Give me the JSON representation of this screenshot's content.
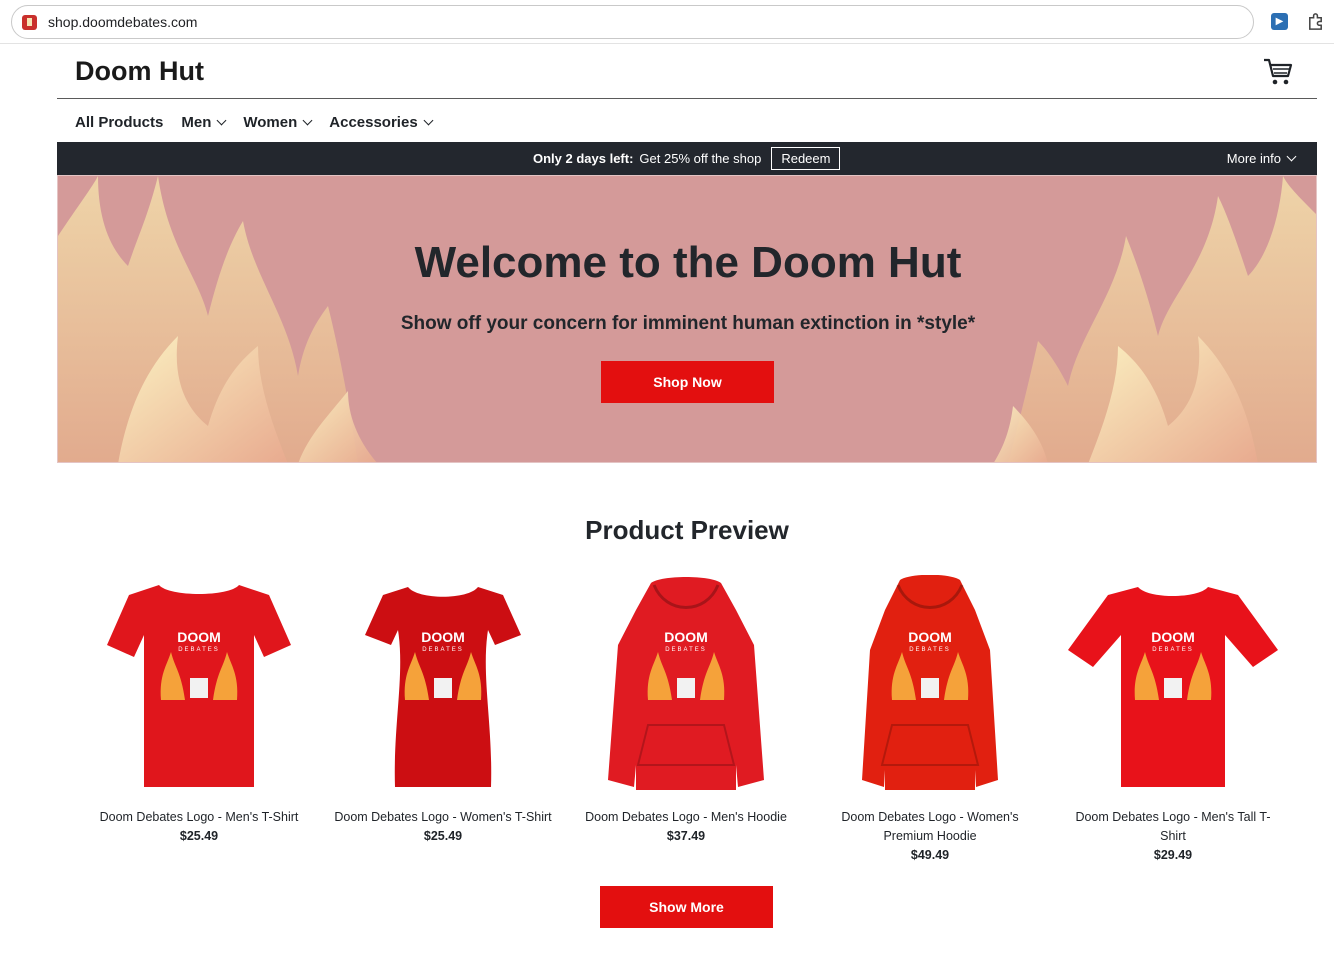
{
  "browser": {
    "url": "shop.doomdebates.com",
    "favicon_icon": "fire-house-icon",
    "extension_icons": [
      "fast-forward-icon",
      "puzzle-piece-icon"
    ]
  },
  "header": {
    "site_title": "Doom Hut",
    "cart_icon": "shopping-cart-icon"
  },
  "nav": {
    "items": [
      {
        "label": "All Products",
        "has_dropdown": false
      },
      {
        "label": "Men",
        "has_dropdown": true
      },
      {
        "label": "Women",
        "has_dropdown": true
      },
      {
        "label": "Accessories",
        "has_dropdown": true
      }
    ]
  },
  "promo": {
    "strong": "Only 2 days left:",
    "text": "Get 25% off the shop",
    "redeem_label": "Redeem",
    "more_info_label": "More info"
  },
  "hero": {
    "title": "Welcome to the Doom Hut",
    "subtitle": "Show off your concern for imminent human extinction in *style*",
    "cta_label": "Shop Now"
  },
  "products_section": {
    "title": "Product Preview",
    "items": [
      {
        "name": "Doom Debates Logo - Men's T-Shirt",
        "price": "$25.49",
        "kind": "tshirt",
        "color": "#e0161c"
      },
      {
        "name": "Doom Debates Logo - Women's T-Shirt",
        "price": "$25.49",
        "kind": "womens-tshirt",
        "color": "#cc0e12"
      },
      {
        "name": "Doom Debates Logo - Men's Hoodie",
        "price": "$37.49",
        "kind": "hoodie",
        "color": "#e01b22"
      },
      {
        "name": "Doom Debates Logo - Women's Premium Hoodie",
        "price": "$49.49",
        "kind": "premium-hoodie",
        "color": "#e12010"
      },
      {
        "name": "Doom Debates Logo - Men's Tall T-Shirt",
        "price": "$29.49",
        "kind": "tall-tshirt",
        "color": "#e8121a"
      }
    ],
    "logo_text": "DOOM",
    "logo_subtext": "DEBATES",
    "show_more_label": "Show More"
  },
  "colors": {
    "accent_red": "#e30f0f",
    "promo_bg": "#23272e",
    "hero_bg": "#d49a99"
  }
}
